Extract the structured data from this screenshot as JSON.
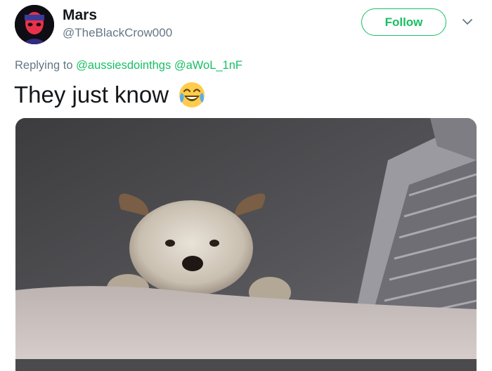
{
  "tweet": {
    "author_name": "Mars",
    "author_handle": "@TheBlackCrow000",
    "follow_label": "Follow",
    "replying_prefix": "Replying to",
    "mentions": [
      "@aussiesdointhgs",
      "@aWoL_1nF"
    ],
    "text": "They just know",
    "emoji": "face-with-tears-of-joy-icon",
    "media": "photo of a small dog peeking over a bed"
  },
  "colors": {
    "accent": "#17bf63",
    "secondary_text": "#657786",
    "primary_text": "#14171a"
  }
}
